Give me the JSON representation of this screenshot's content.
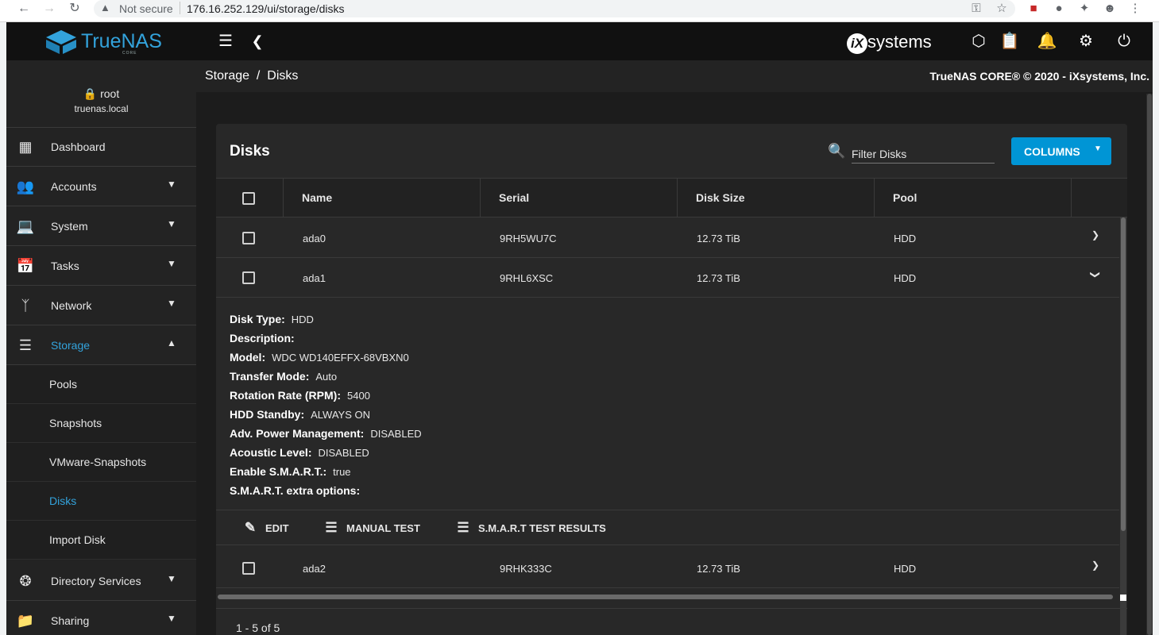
{
  "browser": {
    "security_label": "Not secure",
    "url": "176.16.252.129/ui/storage/disks"
  },
  "header": {
    "brand": "TrueNAS",
    "brand_sub": "CORE",
    "vendor": "systems",
    "vendor_mark": "iX"
  },
  "user": {
    "name": "root",
    "host": "truenas.local"
  },
  "sidebar": {
    "items": [
      {
        "label": "Dashboard"
      },
      {
        "label": "Accounts"
      },
      {
        "label": "System"
      },
      {
        "label": "Tasks"
      },
      {
        "label": "Network"
      },
      {
        "label": "Storage"
      },
      {
        "label": "Directory Services"
      },
      {
        "label": "Sharing"
      }
    ],
    "storage_sub": [
      {
        "label": "Pools"
      },
      {
        "label": "Snapshots"
      },
      {
        "label": "VMware-Snapshots"
      },
      {
        "label": "Disks"
      },
      {
        "label": "Import Disk"
      }
    ]
  },
  "breadcrumb": {
    "path": "Storage  /  Disks",
    "copyright": "TrueNAS CORE® © 2020 - iXsystems, Inc."
  },
  "card": {
    "title": "Disks",
    "filter_placeholder": "Filter Disks",
    "columns_label": "COLUMNS"
  },
  "table": {
    "headers": [
      "Name",
      "Serial",
      "Disk Size",
      "Pool"
    ],
    "rows": [
      {
        "name": "ada0",
        "serial": "9RH5WU7C",
        "size": "12.73 TiB",
        "pool": "HDD"
      },
      {
        "name": "ada1",
        "serial": "9RHL6XSC",
        "size": "12.73 TiB",
        "pool": "HDD"
      },
      {
        "name": "ada2",
        "serial": "9RHK333C",
        "size": "12.73 TiB",
        "pool": "HDD"
      }
    ]
  },
  "details": [
    {
      "label": "Disk Type:",
      "value": "HDD"
    },
    {
      "label": "Description:",
      "value": ""
    },
    {
      "label": "Model:",
      "value": "WDC WD140EFFX-68VBXN0"
    },
    {
      "label": "Transfer Mode:",
      "value": "Auto"
    },
    {
      "label": "Rotation Rate (RPM):",
      "value": "5400"
    },
    {
      "label": "HDD Standby:",
      "value": "ALWAYS ON"
    },
    {
      "label": "Adv. Power Management:",
      "value": "DISABLED"
    },
    {
      "label": "Acoustic Level:",
      "value": "DISABLED"
    },
    {
      "label": "Enable S.M.A.R.T.:",
      "value": "true"
    },
    {
      "label": "S.M.A.R.T. extra options:",
      "value": ""
    }
  ],
  "actions": {
    "edit": "EDIT",
    "manual_test": "MANUAL TEST",
    "smart_results": "S.M.A.R.T TEST RESULTS"
  },
  "pagination": "1 - 5 of 5",
  "colors": {
    "accent": "#0095d5",
    "brand": "#33a3dc",
    "background": "#1c1c1c"
  }
}
